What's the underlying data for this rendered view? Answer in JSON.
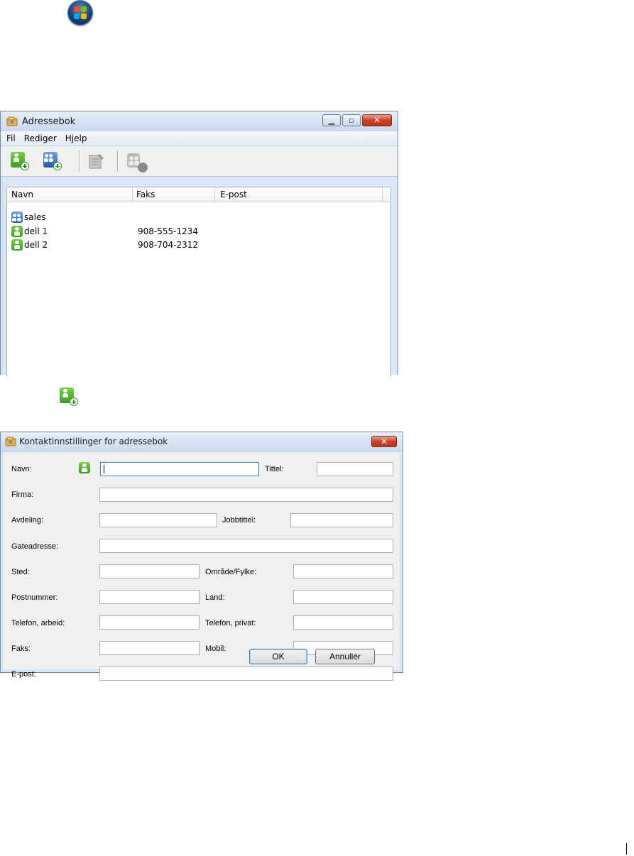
{
  "start_orb": {
    "icon": "windows-start-orb-icon"
  },
  "address_book": {
    "title": "Adressebok",
    "menu": [
      "Fil",
      "Rediger",
      "Hjelp"
    ],
    "toolbar": [
      "new-contact-icon",
      "new-group-icon",
      "properties-icon",
      "delete-contact-icon"
    ],
    "columns": [
      "Navn",
      "Faks",
      "E-post"
    ],
    "rows": [
      {
        "name": "sales",
        "fax": "",
        "email": "",
        "type": "group"
      },
      {
        "name": "dell 1",
        "fax": "908-555-1234",
        "email": "",
        "type": "contact"
      },
      {
        "name": "dell 2",
        "fax": "908-704-2312",
        "email": "",
        "type": "contact"
      }
    ]
  },
  "instruction_icon": "new-contact-icon",
  "contact_dialog": {
    "title": "Kontaktinnstillinger for adressebok",
    "labels": {
      "navn": "Navn:",
      "tittel": "Tittel:",
      "firma": "Firma:",
      "avdeling": "Avdeling:",
      "jobbtittel": "Jobbtittel:",
      "gateadresse": "Gateadresse:",
      "sted": "Sted:",
      "omrade": "Område/Fylke:",
      "postnummer": "Postnummer:",
      "land": "Land:",
      "telefon_arbeid": "Telefon, arbeid:",
      "telefon_privat": "Telefon, privat:",
      "faks": "Faks:",
      "mobil": "Mobil:",
      "epost": "E-post:"
    },
    "values": {
      "navn": "",
      "tittel": "",
      "firma": "",
      "avdeling": "",
      "jobbtittel": "",
      "gateadresse": "",
      "sted": "",
      "omrade": "",
      "postnummer": "",
      "land": "",
      "telefon_arbeid": "",
      "telefon_privat": "",
      "faks": "",
      "mobil": "",
      "epost": ""
    },
    "ok_label": "OK",
    "cancel_label": "Annullér"
  }
}
